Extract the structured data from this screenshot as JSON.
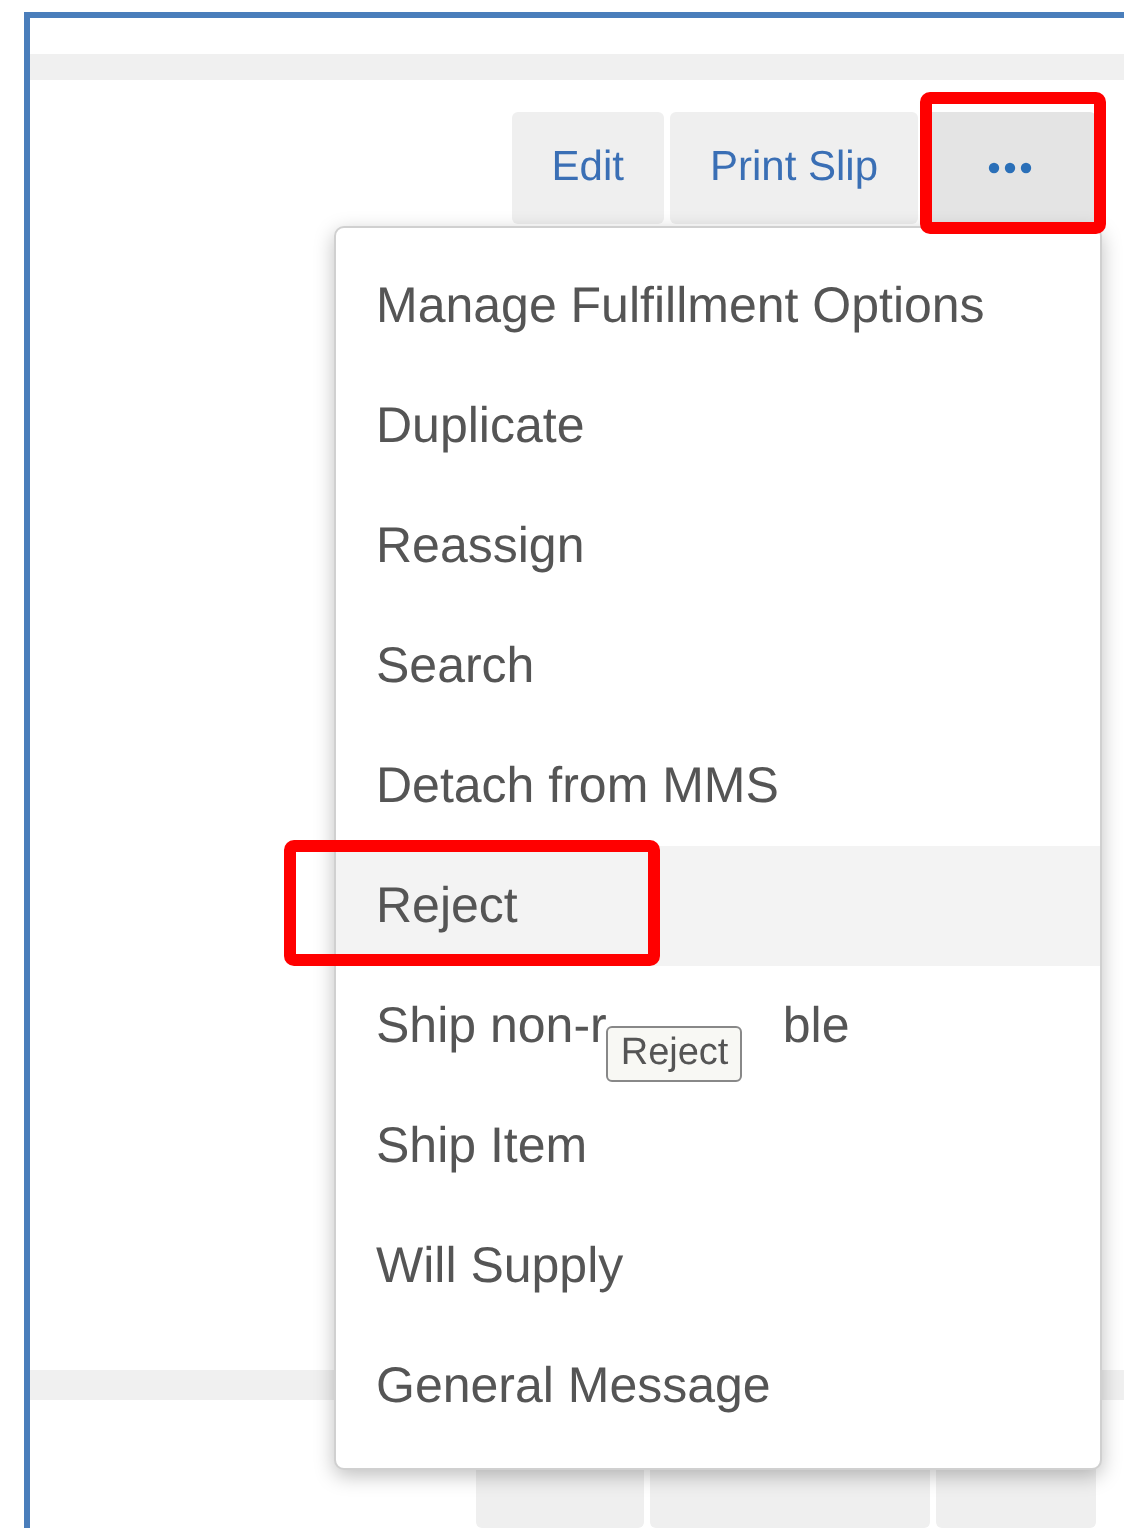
{
  "toolbar": {
    "buttons": [
      {
        "kind": "text",
        "label": "Edit"
      },
      {
        "kind": "text",
        "label": "Print Slip"
      },
      {
        "kind": "more",
        "selected": true
      }
    ]
  },
  "menu": {
    "items": [
      {
        "label": "Manage Fulfillment Options",
        "selected": false
      },
      {
        "label": "Duplicate",
        "selected": false
      },
      {
        "label": "Reassign",
        "selected": false
      },
      {
        "label": "Search",
        "selected": false
      },
      {
        "label": "Detach from MMS",
        "selected": false
      },
      {
        "label": "Reject",
        "selected": true
      },
      {
        "kind": "split",
        "parts": [
          "Ship non-r",
          "ble"
        ],
        "selected": false
      },
      {
        "label": "Ship Item",
        "selected": false
      },
      {
        "label": "Will Supply",
        "selected": false
      },
      {
        "label": "General Message",
        "selected": false
      }
    ]
  },
  "tooltip": {
    "text": "Reject"
  }
}
